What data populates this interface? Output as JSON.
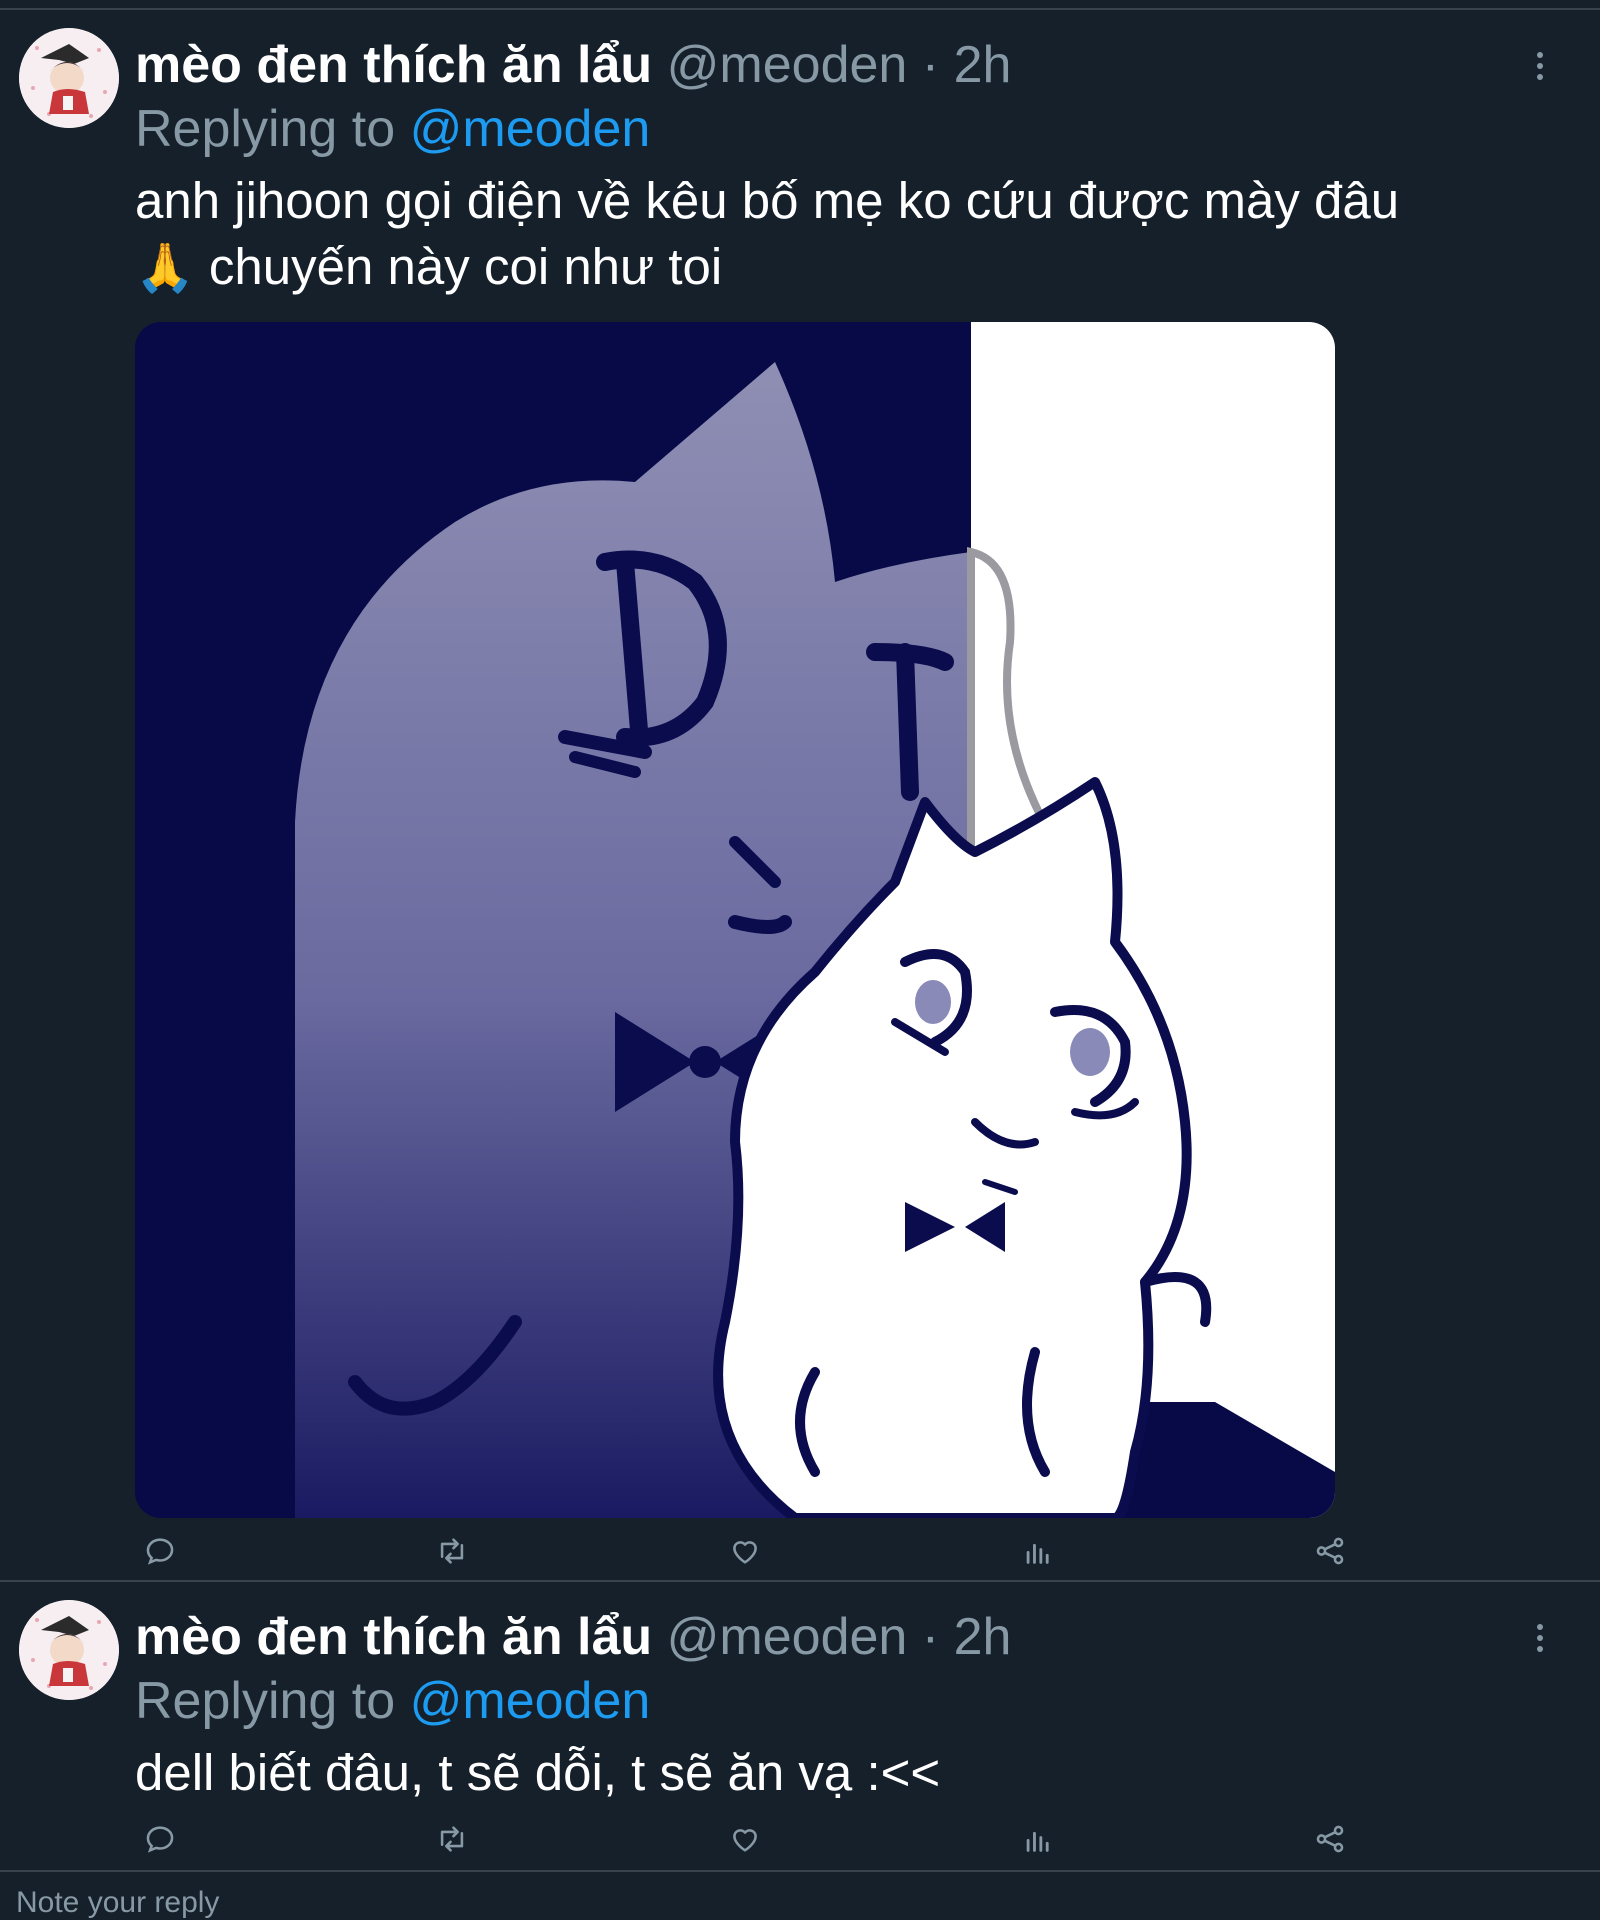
{
  "thread": {
    "tweets": [
      {
        "display_name": "mèo đen thích ăn lẩu",
        "handle": "@meoden",
        "separator": "·",
        "time": "2h",
        "replying_prefix": "Replying to",
        "replying_to": "@meoden",
        "text_line1": "anh jihoon gọi điện về kêu bố mẹ ko cứu được mày đâu",
        "text_line2_emoji": "🙏",
        "text_line2": " chuyến này coi như toi",
        "has_media": true,
        "media_icon": "black-white-cat-meme"
      },
      {
        "display_name": "mèo đen thích ăn lẩu",
        "handle": "@meoden",
        "separator": "·",
        "time": "2h",
        "replying_prefix": "Replying to",
        "replying_to": "@meoden",
        "text_line1": "dell biết đâu, t sẽ dỗi, t sẽ ăn vạ :<<",
        "has_media": false
      }
    ]
  },
  "action_icons": [
    "reply-icon",
    "retweet-icon",
    "like-icon",
    "views-icon",
    "share-icon"
  ],
  "reply_box": {
    "placeholder": "Note your reply"
  },
  "colors": {
    "background": "#15202b",
    "divider": "#38444d",
    "secondary_text": "#8899a6",
    "mention": "#1d9bf0",
    "media_dark": "#0b0f4a",
    "media_light": "#ffffff"
  }
}
